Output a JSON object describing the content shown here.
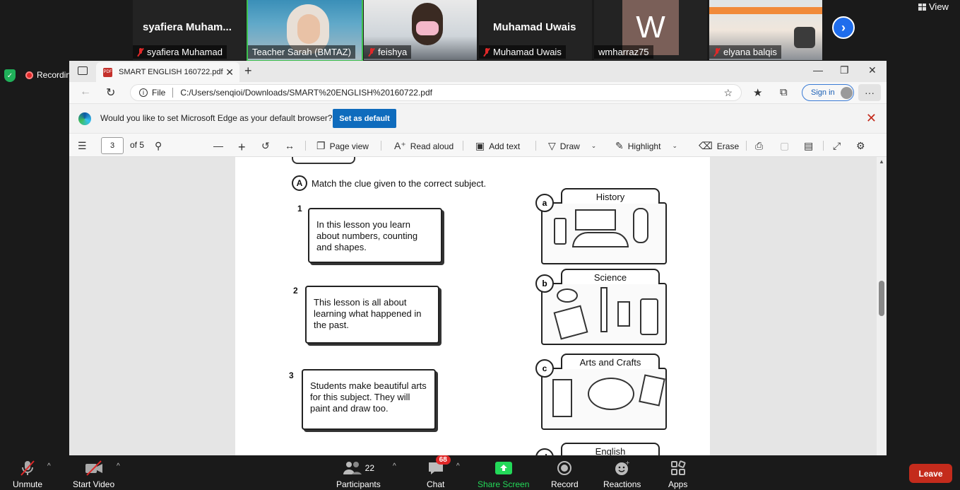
{
  "zoom": {
    "participants_strip": [
      {
        "big_name": "syafiera  Muham...",
        "nameplate": "syafiera Muhamad",
        "muted": true
      },
      {
        "big_name": "",
        "nameplate": "Teacher Sarah (BMTAZ)",
        "muted": false
      },
      {
        "big_name": "",
        "nameplate": "feishya",
        "muted": true
      },
      {
        "big_name": "Muhamad Uwais",
        "nameplate": "Muhamad Uwais",
        "muted": true
      },
      {
        "big_name": "",
        "nameplate": "wmharraz75",
        "muted": false,
        "avatar_letter": "W"
      },
      {
        "big_name": "",
        "nameplate": "elyana balqis",
        "muted": true
      }
    ],
    "view_label": "View",
    "recording_label": "Recording...",
    "bottom": {
      "unmute": "Unmute",
      "start_video": "Start Video",
      "participants": "Participants",
      "participants_count": "22",
      "chat": "Chat",
      "chat_badge": "68",
      "share_screen": "Share Screen",
      "record": "Record",
      "reactions": "Reactions",
      "apps": "Apps",
      "leave": "Leave"
    }
  },
  "edge": {
    "tab_title": "SMART ENGLISH 160722.pdf",
    "file_label": "File",
    "url": "C:/Users/senqioi/Downloads/SMART%20ENGLISH%20160722.pdf",
    "signin": "Sign in",
    "default_prompt": "Would you like to set Microsoft Edge as your default browser?",
    "set_default": "Set as default",
    "pdf_toolbar": {
      "page_current": "3",
      "page_total": "of 5",
      "page_view": "Page view",
      "read_aloud": "Read aloud",
      "add_text": "Add text",
      "draw": "Draw",
      "highlight": "Highlight",
      "erase": "Erase"
    }
  },
  "worksheet": {
    "instruction": "Match the clue given to the correct subject.",
    "section_letter": "A",
    "clues": [
      {
        "num": "1",
        "text": "In this lesson you learn about numbers, counting and shapes."
      },
      {
        "num": "2",
        "text": "This lesson is all about learning what happened in the past."
      },
      {
        "num": "3",
        "text": "Students make beautiful arts for this subject. They will paint and draw too."
      }
    ],
    "subjects": [
      {
        "letter": "a",
        "name": "History"
      },
      {
        "letter": "b",
        "name": "Science"
      },
      {
        "letter": "c",
        "name": "Arts and Crafts"
      },
      {
        "letter": "d",
        "name": "English"
      }
    ]
  },
  "colors": {
    "zoom_bg": "#1a1a1a",
    "edge_blue": "#0f6cbd",
    "leave_red": "#c42b1c",
    "share_green": "#23d959"
  }
}
